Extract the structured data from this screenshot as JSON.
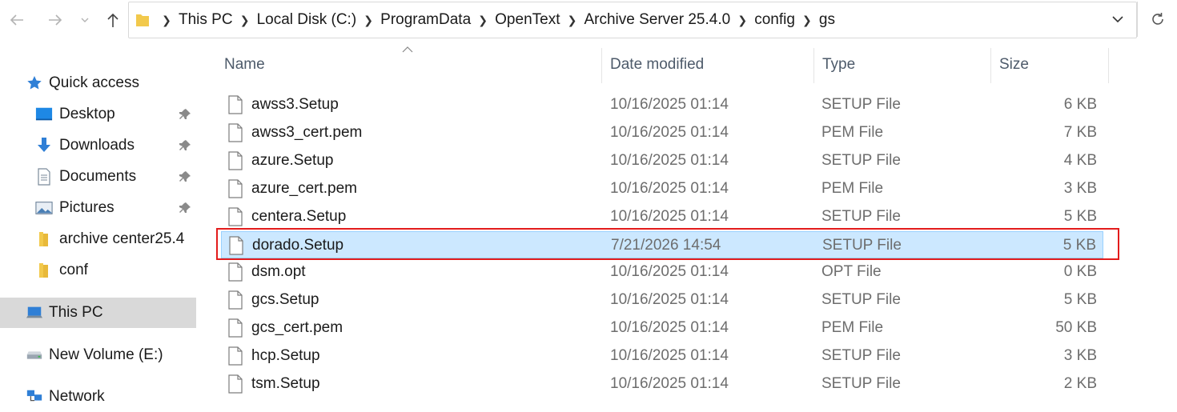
{
  "address_bar": {
    "breadcrumbs": [
      "This PC",
      "Local Disk (C:)",
      "ProgramData",
      "OpenText",
      "Archive Server 25.4.0",
      "config",
      "gs"
    ]
  },
  "nav_pane": {
    "quick_access": "Quick access",
    "pinned": [
      "Desktop",
      "Downloads",
      "Documents",
      "Pictures"
    ],
    "folders": [
      "archive center25.4",
      "conf"
    ],
    "this_pc": "This PC",
    "new_volume": "New Volume (E:)",
    "network": "Network"
  },
  "file_list": {
    "columns": {
      "name": "Name",
      "date": "Date modified",
      "type": "Type",
      "size": "Size"
    },
    "rows": [
      {
        "name": "awss3.Setup",
        "date": "10/16/2025 01:14",
        "type": "SETUP File",
        "size": "6 KB"
      },
      {
        "name": "awss3_cert.pem",
        "date": "10/16/2025 01:14",
        "type": "PEM File",
        "size": "7 KB"
      },
      {
        "name": "azure.Setup",
        "date": "10/16/2025 01:14",
        "type": "SETUP File",
        "size": "4 KB"
      },
      {
        "name": "azure_cert.pem",
        "date": "10/16/2025 01:14",
        "type": "PEM File",
        "size": "3 KB"
      },
      {
        "name": "centera.Setup",
        "date": "10/16/2025 01:14",
        "type": "SETUP File",
        "size": "5 KB"
      },
      {
        "name": "dorado.Setup",
        "date": "7/21/2026 14:54",
        "type": "SETUP File",
        "size": "5 KB",
        "selected": true
      },
      {
        "name": "dsm.opt",
        "date": "10/16/2025 01:14",
        "type": "OPT File",
        "size": "0 KB"
      },
      {
        "name": "gcs.Setup",
        "date": "10/16/2025 01:14",
        "type": "SETUP File",
        "size": "5 KB"
      },
      {
        "name": "gcs_cert.pem",
        "date": "10/16/2025 01:14",
        "type": "PEM File",
        "size": "50 KB"
      },
      {
        "name": "hcp.Setup",
        "date": "10/16/2025 01:14",
        "type": "SETUP File",
        "size": "3 KB"
      },
      {
        "name": "tsm.Setup",
        "date": "10/16/2025 01:14",
        "type": "SETUP File",
        "size": "2 KB"
      }
    ]
  },
  "colors": {
    "selection_bg": "#cce8ff",
    "selection_border": "#99d1ff",
    "highlight": "#e31c1c",
    "folder": "#f2c94c"
  }
}
